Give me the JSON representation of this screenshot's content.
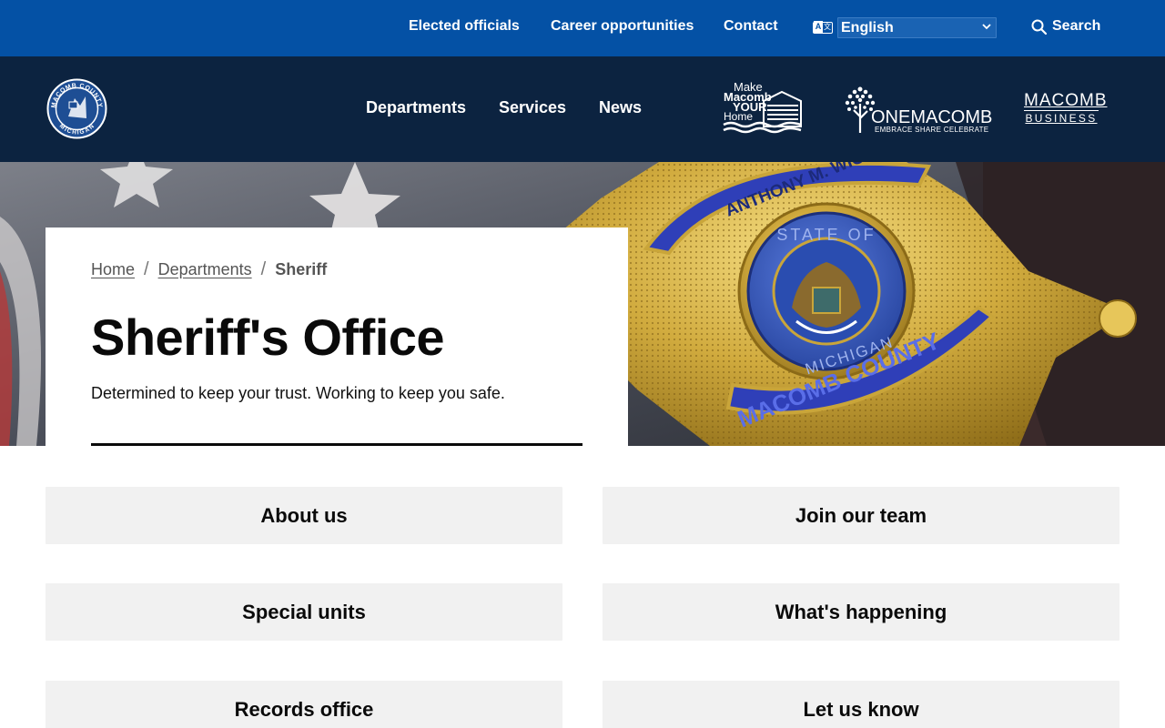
{
  "utility_nav": {
    "elected_officials": "Elected officials",
    "career_opportunities": "Career opportunities",
    "contact": "Contact",
    "language_selected": "English",
    "language_options": [
      "English"
    ],
    "search_label": "Search"
  },
  "main_nav": {
    "seal_text_top": "MACOMB COUNTY",
    "seal_text_bottom": "MICHIGAN",
    "links": {
      "departments": "Departments",
      "services": "Services",
      "news": "News"
    },
    "make_macomb": {
      "line1": "Make",
      "line2": "Macomb",
      "line3": "YOUR",
      "line4": "Home"
    },
    "onemacomb": {
      "title": "ONEMACOMB",
      "tagline": "EMBRACE SHARE CELEBRATE"
    },
    "macomb_business": {
      "line1": "MACOMB",
      "line2": "BUSINESS"
    }
  },
  "hero": {
    "breadcrumb": {
      "home": "Home",
      "departments": "Departments",
      "current": "Sheriff"
    },
    "title": "Sheriff's Office",
    "tagline": "Determined to keep your trust. Working to keep you safe.",
    "badge_text_top": "ANTHONY M. WICKERSHAW",
    "badge_text_state": "STATE OF",
    "badge_text_michigan": "MICHIGAN",
    "badge_text_bottom": "MACOMB COUNTY"
  },
  "tiles": {
    "about_us": "About us",
    "join_our_team": "Join our team",
    "special_units": "Special units",
    "whats_happening": "What's happening",
    "records_office": "Records office",
    "let_us_know": "Let us know"
  },
  "colors": {
    "utility_bar": "#0451a5",
    "main_nav": "#0c2340",
    "tile_bg": "#f1f1f1",
    "badge_gold": "#c9a53a",
    "badge_blue": "#2b4fb5"
  }
}
